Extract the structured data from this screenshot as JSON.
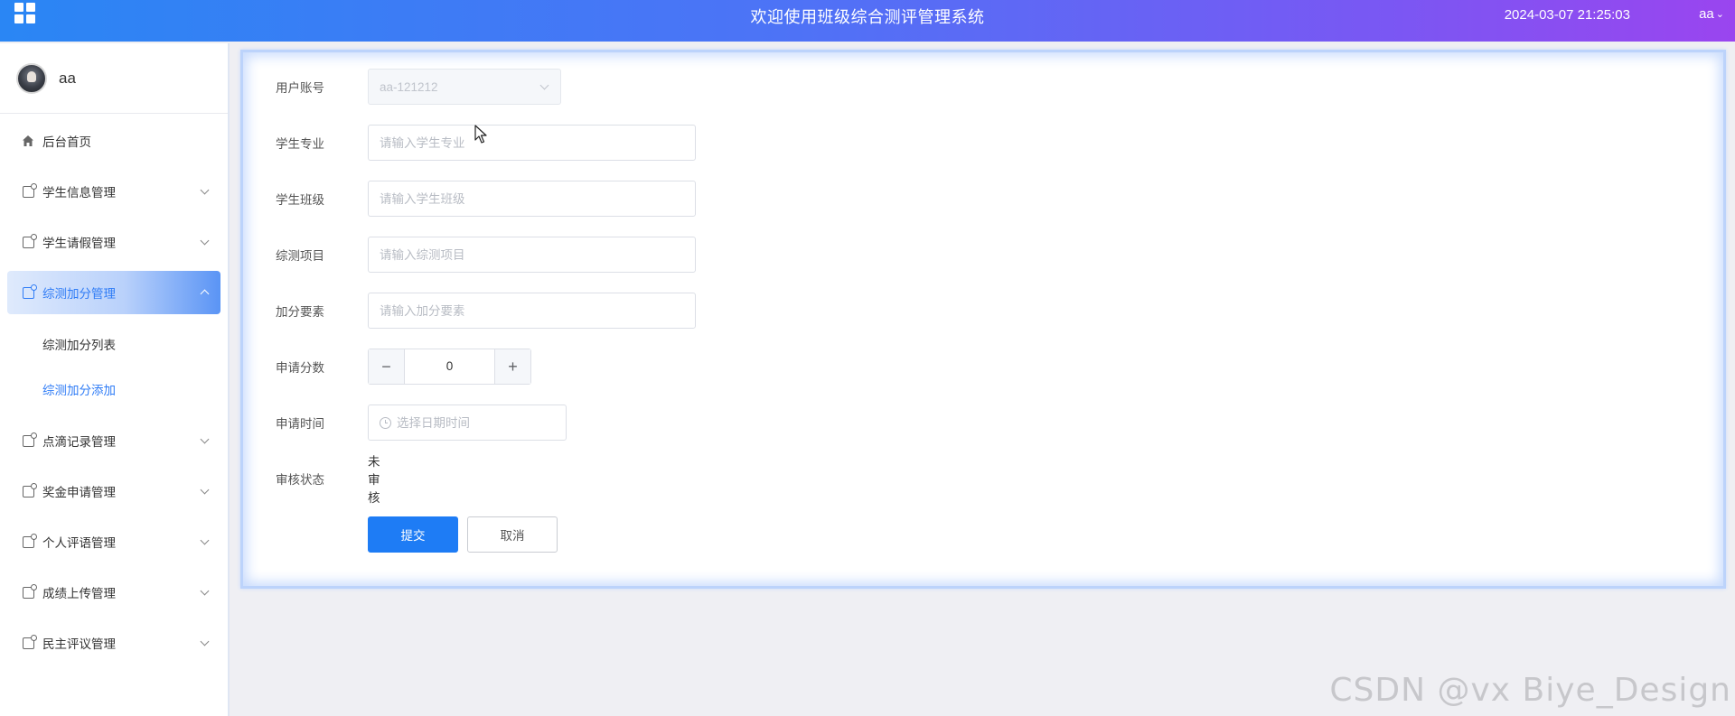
{
  "header": {
    "title": "欢迎使用班级综合测评管理系统",
    "datetime": "2024-03-07 21:25:03",
    "user": "aa"
  },
  "sidebar": {
    "profile_name": "aa",
    "home_label": "后台首页",
    "items": [
      {
        "label": "学生信息管理"
      },
      {
        "label": "学生请假管理"
      },
      {
        "label": "综测加分管理",
        "active": true
      },
      {
        "label": "点滴记录管理"
      },
      {
        "label": "奖金申请管理"
      },
      {
        "label": "个人评语管理"
      },
      {
        "label": "成绩上传管理"
      },
      {
        "label": "民主评议管理"
      }
    ],
    "submenu": [
      {
        "label": "综测加分列表"
      },
      {
        "label": "综测加分添加",
        "selected": true
      }
    ]
  },
  "form": {
    "account": {
      "label": "用户账号",
      "value": "aa-121212"
    },
    "major": {
      "label": "学生专业",
      "placeholder": "请输入学生专业"
    },
    "class": {
      "label": "学生班级",
      "placeholder": "请输入学生班级"
    },
    "project": {
      "label": "综测项目",
      "placeholder": "请输入综测项目"
    },
    "factor": {
      "label": "加分要素",
      "placeholder": "请输入加分要素"
    },
    "score": {
      "label": "申请分数",
      "value": "0",
      "minus": "−",
      "plus": "+"
    },
    "time": {
      "label": "申请时间",
      "placeholder": "选择日期时间"
    },
    "status": {
      "label": "审核状态",
      "value": "未审核"
    },
    "submit_label": "提交",
    "cancel_label": "取消"
  },
  "watermark": "CSDN @vx  Biye_Design",
  "colors": {
    "accent": "#1e7cf5",
    "header_start": "#2a86f4",
    "header_end": "#9a45ef"
  }
}
